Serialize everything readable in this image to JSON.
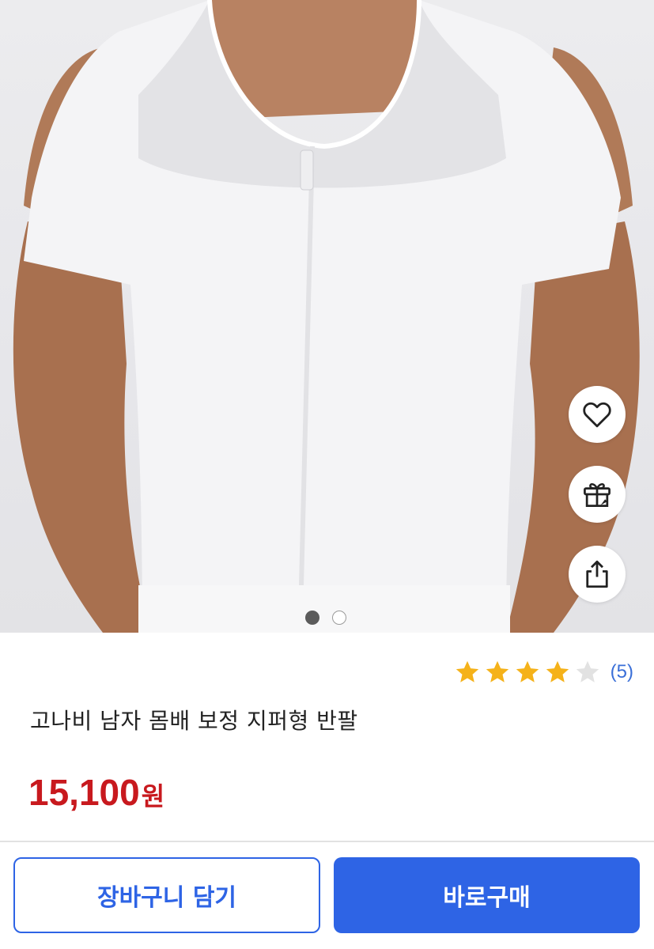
{
  "product_image": {
    "alt": "고나비 남자 몸배 보정 지퍼형 반팔",
    "page_indicator": {
      "total": 2,
      "current": 1
    }
  },
  "actions": {
    "wishlist_icon": "heart-icon",
    "gift_icon": "gift-icon",
    "share_icon": "share-icon"
  },
  "rating": {
    "stars": 4,
    "max": 5,
    "review_count": "(5)"
  },
  "product": {
    "name": "고나비 남자 몸배 보정 지퍼형 반팔",
    "price": "15,100",
    "currency": "원"
  },
  "buttons": {
    "cart": "장바구니 담기",
    "buy": "바로구매"
  },
  "colors": {
    "accent": "#2e64e5",
    "price": "#c8191e",
    "star_filled": "#f5b21a",
    "star_empty": "#e2e2e2",
    "review_count": "#3a6fd8"
  }
}
